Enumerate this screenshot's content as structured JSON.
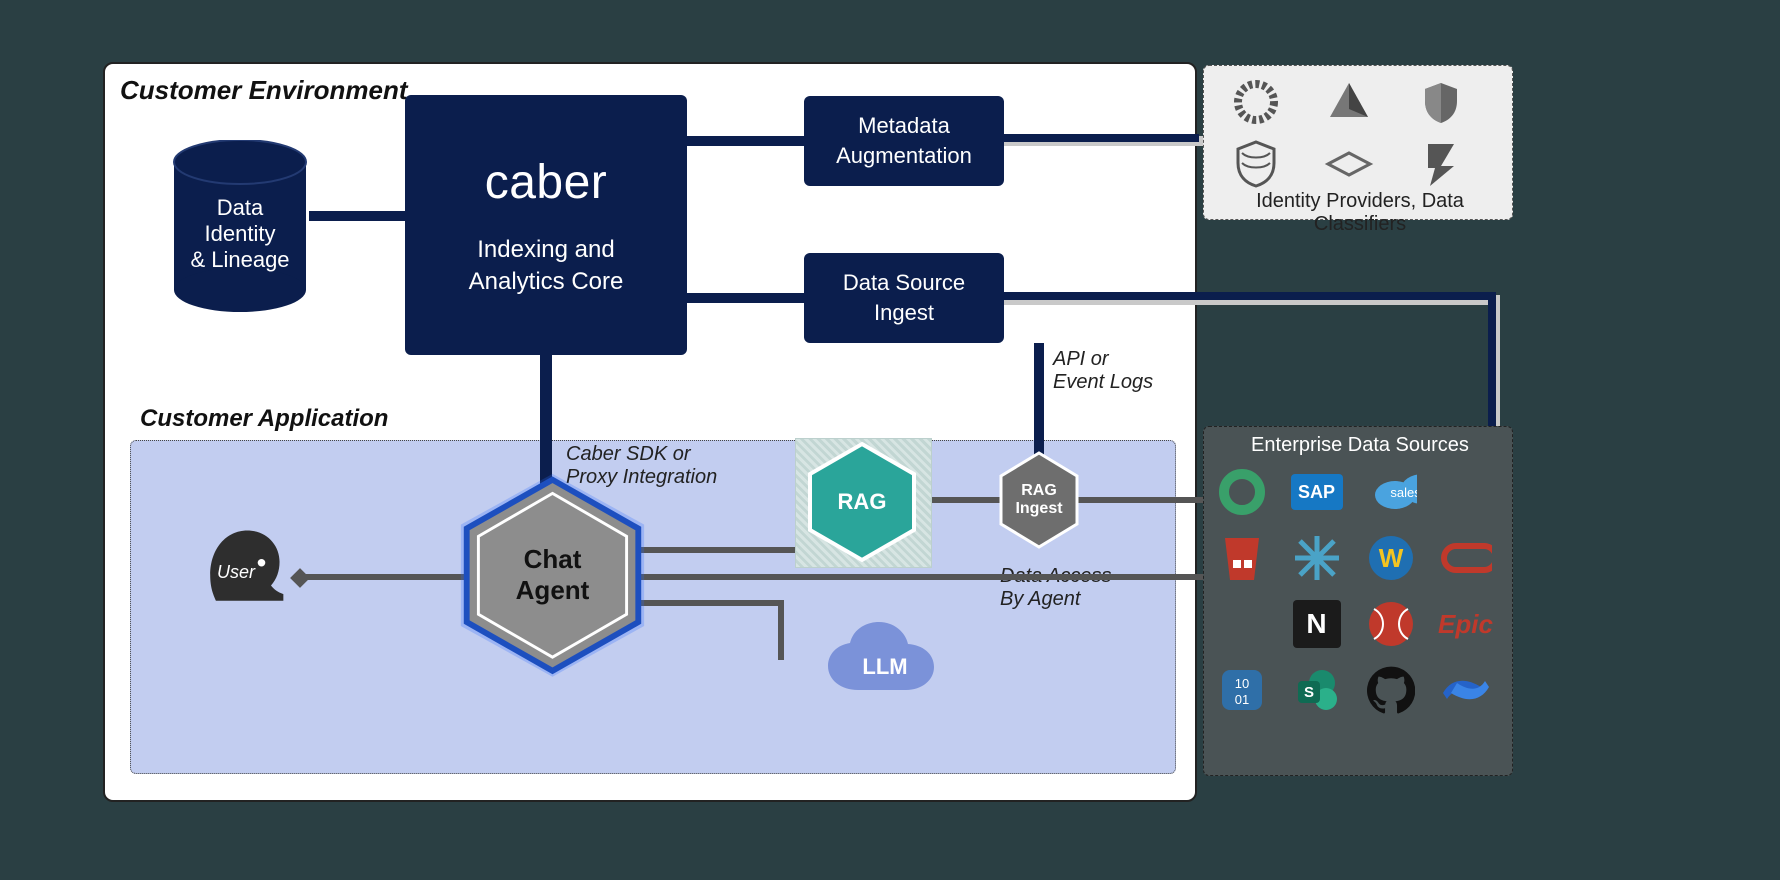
{
  "env_title": "Customer Environment",
  "app_title": "Customer Application",
  "caber_brand": "caber",
  "caber_subtitle": "Indexing and\nAnalytics Core",
  "data_lineage": "Data\nIdentity\n& Lineage",
  "metadata_aug": "Metadata\nAugmentation",
  "data_source_ingest": "Data Source\nIngest",
  "sdk_note": "Caber SDK or\nProxy Integration",
  "api_note": "API or\nEvent Logs",
  "data_access_note": "Data Access\nBy Agent",
  "user_label": "User",
  "chat_agent": "Chat\nAgent",
  "rag": "RAG",
  "rag_ingest": "RAG\nIngest",
  "llm": "LLM",
  "idp_label": "Identity Providers, Data Classifiers",
  "eds_label": "Enterprise Data Sources",
  "eds_icons": [
    "azure-ad",
    "sap",
    "salesforce",
    "aws-s3",
    "snowflake",
    "workday",
    "oracle",
    "netsuite",
    "cohere",
    "epic",
    "harness",
    "sharepoint",
    "github",
    "confluence"
  ],
  "colors": {
    "navy": "#0b1e4d",
    "teal": "#2aa59a",
    "app": "#c2cdf0",
    "llm": "#7b92d9",
    "gray": "#7a7a7a",
    "eds": "#4a5355"
  }
}
